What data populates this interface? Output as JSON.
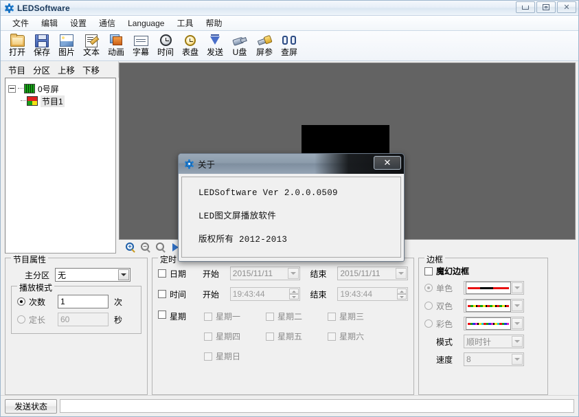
{
  "window": {
    "title": "LEDSoftware",
    "icon": "gear-icon",
    "minimize_label": "",
    "maximize_label": "",
    "close_label": "✕"
  },
  "menubar": {
    "items": [
      {
        "label": "文件",
        "name": "menu-file"
      },
      {
        "label": "编辑",
        "name": "menu-edit"
      },
      {
        "label": "设置",
        "name": "menu-settings"
      },
      {
        "label": "通信",
        "name": "menu-communication"
      },
      {
        "label": "Language",
        "name": "menu-language"
      },
      {
        "label": "工具",
        "name": "menu-tools"
      },
      {
        "label": "帮助",
        "name": "menu-help"
      }
    ]
  },
  "toolbar": {
    "items": [
      {
        "label": "打开",
        "icon": "open-folder-icon",
        "name": "toolbar-open"
      },
      {
        "label": "保存",
        "icon": "save-disk-icon",
        "name": "toolbar-save"
      },
      {
        "label": "图片",
        "icon": "picture-icon",
        "name": "toolbar-picture"
      },
      {
        "label": "文本",
        "icon": "text-edit-icon",
        "name": "toolbar-text"
      },
      {
        "label": "动画",
        "icon": "animation-icon",
        "name": "toolbar-animation"
      },
      {
        "label": "字幕",
        "icon": "subtitle-icon",
        "name": "toolbar-subtitle"
      },
      {
        "label": "时间",
        "icon": "clock-icon",
        "name": "toolbar-time"
      },
      {
        "label": "表盘",
        "icon": "alarm-clock-icon",
        "name": "toolbar-dial"
      },
      {
        "label": "发送",
        "icon": "send-arrow-icon",
        "name": "toolbar-send"
      },
      {
        "label": "U盘",
        "icon": "usb-drive-icon",
        "name": "toolbar-usb"
      },
      {
        "label": "屏参",
        "icon": "wrench-icon",
        "name": "toolbar-screen-params"
      },
      {
        "label": "查屏",
        "icon": "binoculars-icon",
        "name": "toolbar-check-screen"
      }
    ]
  },
  "tree_toolbar": {
    "buttons": [
      {
        "label": "节目",
        "name": "tree-btn-program"
      },
      {
        "label": "分区",
        "name": "tree-btn-partition"
      },
      {
        "label": "上移",
        "name": "tree-btn-move-up"
      },
      {
        "label": "下移",
        "name": "tree-btn-move-down"
      }
    ]
  },
  "tree": {
    "root": {
      "label": "0号屏",
      "icon": "led-screen-icon"
    },
    "child": {
      "label": "节目1",
      "icon": "program-icon"
    }
  },
  "preview": {
    "background_color": "#636363",
    "region_color": "#000000",
    "zoom_buttons": [
      {
        "name": "zoom-in-icon",
        "glyph": "+",
        "enabled": true
      },
      {
        "name": "zoom-out-icon",
        "glyph": "−",
        "enabled": false
      },
      {
        "name": "zoom-reset-icon",
        "glyph": "",
        "enabled": false
      },
      {
        "name": "play-icon",
        "glyph": "▶",
        "enabled": true
      }
    ]
  },
  "program_properties": {
    "caption": "节目属性",
    "main_partition_label": "主分区",
    "main_partition_value": "无",
    "play_mode": {
      "caption": "播放模式",
      "count_label": "次数",
      "count_value": "1",
      "count_unit": "次",
      "duration_label": "定长",
      "duration_value": "60",
      "duration_unit": "秒",
      "selected": "次数"
    }
  },
  "schedule": {
    "caption": "定时",
    "date": {
      "checkbox_label": "日期",
      "checked": false,
      "start_label": "开始",
      "start_value": "2015/11/11",
      "end_label": "结束",
      "end_value": "2015/11/11"
    },
    "time": {
      "checkbox_label": "时间",
      "checked": false,
      "start_label": "开始",
      "start_value": "19:43:44",
      "end_label": "结束",
      "end_value": "19:43:44"
    },
    "week": {
      "checkbox_label": "星期",
      "checked": false,
      "days": [
        {
          "label": "星期一",
          "checked": false
        },
        {
          "label": "星期二",
          "checked": false
        },
        {
          "label": "星期三",
          "checked": false
        },
        {
          "label": "星期四",
          "checked": false
        },
        {
          "label": "星期五",
          "checked": false
        },
        {
          "label": "星期六",
          "checked": false
        },
        {
          "label": "星期日",
          "checked": false
        }
      ]
    }
  },
  "border": {
    "caption": "边框",
    "magic_border_label": "魔幻边框",
    "magic_border_checked": false,
    "options": [
      {
        "label": "单色",
        "value": "1",
        "selected": true,
        "swatch": "single-color-swatch"
      },
      {
        "label": "双色",
        "value": "1",
        "selected": false,
        "swatch": "dual-color-swatch"
      },
      {
        "label": "彩色",
        "value": "1",
        "selected": false,
        "swatch": "multi-color-swatch"
      }
    ],
    "mode_label": "模式",
    "mode_value": "顺时针",
    "speed_label": "速度",
    "speed_value": "8"
  },
  "statusbar": {
    "send_status_label": "发送状态",
    "message": ""
  },
  "about_dialog": {
    "title": "关于",
    "icon": "gear-icon",
    "close_label": "✕",
    "line1": "LEDSoftware Ver 2.0.0.0509",
    "line2": "LED图文屏播放软件",
    "line3": "版权所有 2012-2013"
  }
}
